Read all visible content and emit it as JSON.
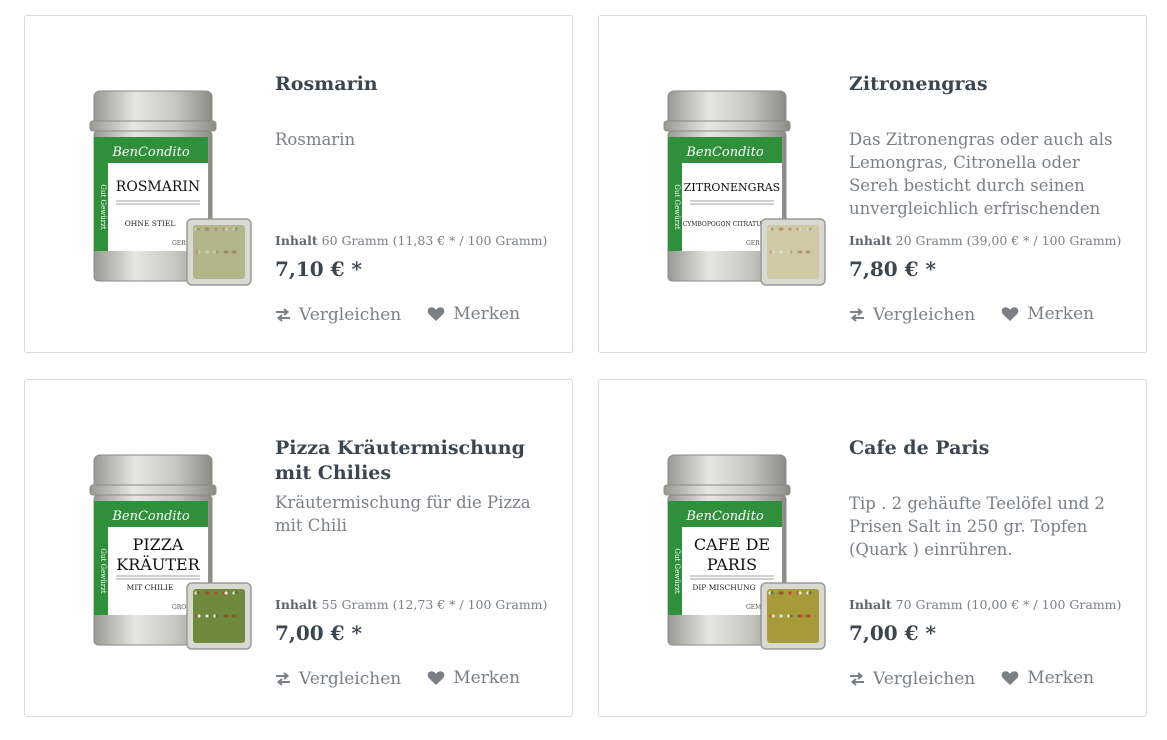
{
  "products": [
    {
      "title": "Rosmarin",
      "description": "Rosmarin",
      "unit_label": "Inhalt",
      "unit_value": "60 Gramm (11,83 € * / 100 Gramm)",
      "price": "7,10 € *",
      "compare_label": "Vergleichen",
      "wishlist_label": "Merken",
      "tin": {
        "brand": "BenCondito",
        "side": "Gut Gewürzt",
        "name_line1": "ROSMARIN",
        "name_line2": "",
        "sub": "OHNE STIEL",
        "grind": "GERI",
        "content_color": "#b3b58a"
      }
    },
    {
      "title": "Zitronengras",
      "description": "Das Zitronengras oder auch als Lemongras, Citronella oder Sereh besticht durch seinen unvergleichlich erfrischenden",
      "unit_label": "Inhalt",
      "unit_value": "20 Gramm (39,00 € * / 100 Gramm)",
      "price": "7,80 € *",
      "compare_label": "Vergleichen",
      "wishlist_label": "Merken",
      "tin": {
        "brand": "BenCondito",
        "side": "Gut Gewürzt",
        "name_line1": "ZITRONENGRAS",
        "name_line2": "",
        "sub": "CYMBOPOGON CITRATUS",
        "grind": "GERI",
        "content_color": "#cfc9a6"
      }
    },
    {
      "title": "Pizza Kräutermischung mit Chilies",
      "description": "Kräutermischung für die Pizza mit Chili",
      "unit_label": "Inhalt",
      "unit_value": "55 Gramm (12,73 € * / 100 Gramm)",
      "price": "7,00 € *",
      "compare_label": "Vergleichen",
      "wishlist_label": "Merken",
      "tin": {
        "brand": "BenCondito",
        "side": "Gut Gewürzt",
        "name_line1": "PIZZA",
        "name_line2": "KRÄUTER",
        "sub": "MIT CHILIE",
        "grind": "GROB GEMAH",
        "content_color": "#6f8a3c"
      }
    },
    {
      "title": "Cafe de Paris",
      "description": "Tip . 2 gehäufte Teelöfel und 2 Prisen Salt in 250 gr. Topfen (Quark ) einrühren.",
      "unit_label": "Inhalt",
      "unit_value": "70 Gramm (10,00 € * / 100 Gramm)",
      "price": "7,00 € *",
      "compare_label": "Vergleichen",
      "wishlist_label": "Merken",
      "tin": {
        "brand": "BenCondito",
        "side": "Gut Gewürzt",
        "name_line1": "CAFE DE",
        "name_line2": "PARIS",
        "sub": "DIP MISCHUNG",
        "grind": "GEMAH",
        "content_color": "#a69a3a"
      }
    }
  ],
  "colors": {
    "accent_green": "#2f8f3a",
    "text_dark": "#3c4650",
    "text_muted": "#7a8086",
    "border": "#dadada"
  },
  "icons": {
    "compare": "compare-arrows-icon",
    "wishlist": "heart-icon"
  }
}
